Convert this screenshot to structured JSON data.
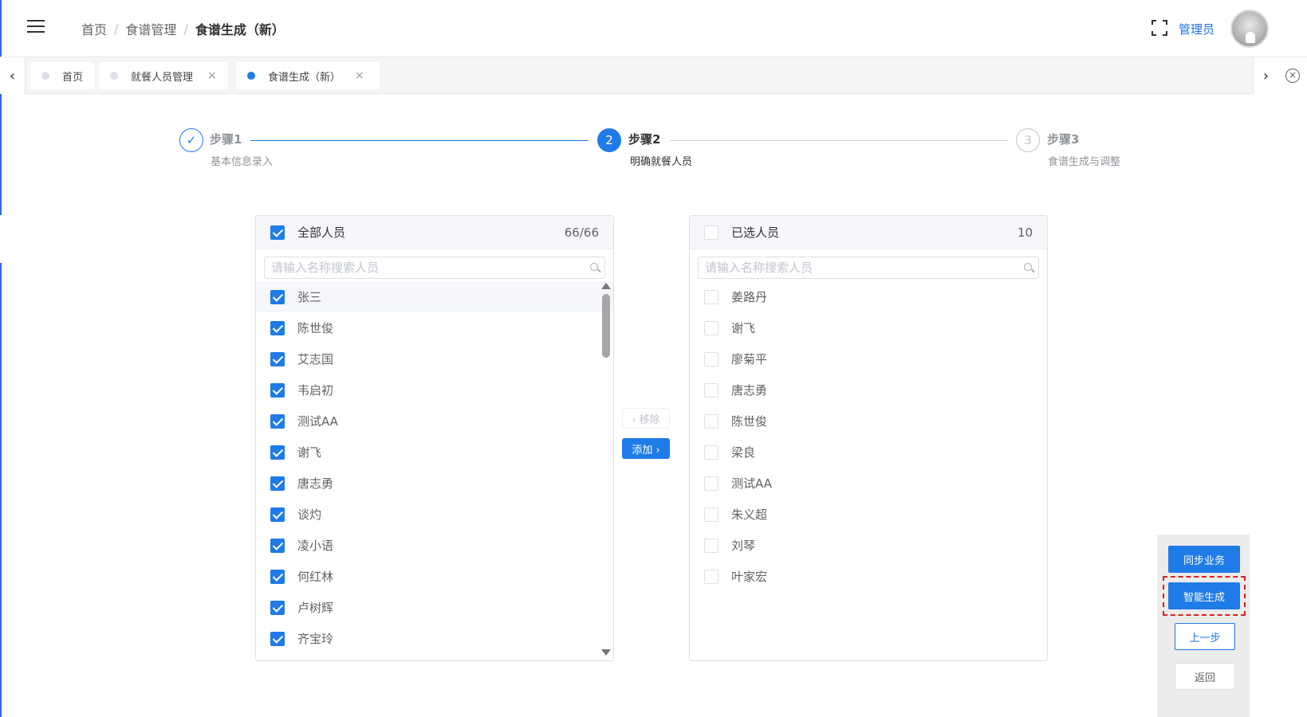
{
  "header": {
    "breadcrumb": [
      "首页",
      "食谱管理",
      "食谱生成（新）"
    ],
    "breadcrumb_sep": "/",
    "user_name": "管理员"
  },
  "tabs": [
    {
      "label": "首页",
      "closable": false,
      "active": false
    },
    {
      "label": "就餐人员管理",
      "closable": true,
      "active": false
    },
    {
      "label": "食谱生成（新）",
      "closable": true,
      "active": true
    }
  ],
  "tab_close_glyph": "×",
  "steps": [
    {
      "number": "",
      "title": "步骤1",
      "description": "基本信息录入",
      "status": "done"
    },
    {
      "number": "2",
      "title": "步骤2",
      "description": "明确就餐人员",
      "status": "active"
    },
    {
      "number": "3",
      "title": "步骤3",
      "description": "食谱生成与调整",
      "status": "wait"
    }
  ],
  "left_panel": {
    "title": "全部人员",
    "count": "66/66",
    "checked": true,
    "search_placeholder": "请输入名称搜索人员",
    "items": [
      "张三",
      "陈世俊",
      "艾志国",
      "韦启初",
      "测试AA",
      "谢飞",
      "唐志勇",
      "谈灼",
      "凌小语",
      "何红林",
      "卢树辉",
      "齐宝玲"
    ]
  },
  "right_panel": {
    "title": "已选人员",
    "count": "10",
    "checked": false,
    "search_placeholder": "请输入名称搜索人员",
    "items": [
      "姜路丹",
      "谢飞",
      "廖菊平",
      "唐志勇",
      "陈世俊",
      "梁良",
      "测试AA",
      "朱义超",
      "刘琴",
      "叶家宏"
    ]
  },
  "transfer": {
    "remove_label": "‹ 移除",
    "add_label": "添加 ›"
  },
  "actions": {
    "sync_label": "同步业务",
    "generate_label": "智能生成",
    "prev_label": "上一步",
    "back_label": "返回"
  },
  "colors": {
    "primary": "#1f7be8",
    "highlight_border": "#d9241c"
  }
}
